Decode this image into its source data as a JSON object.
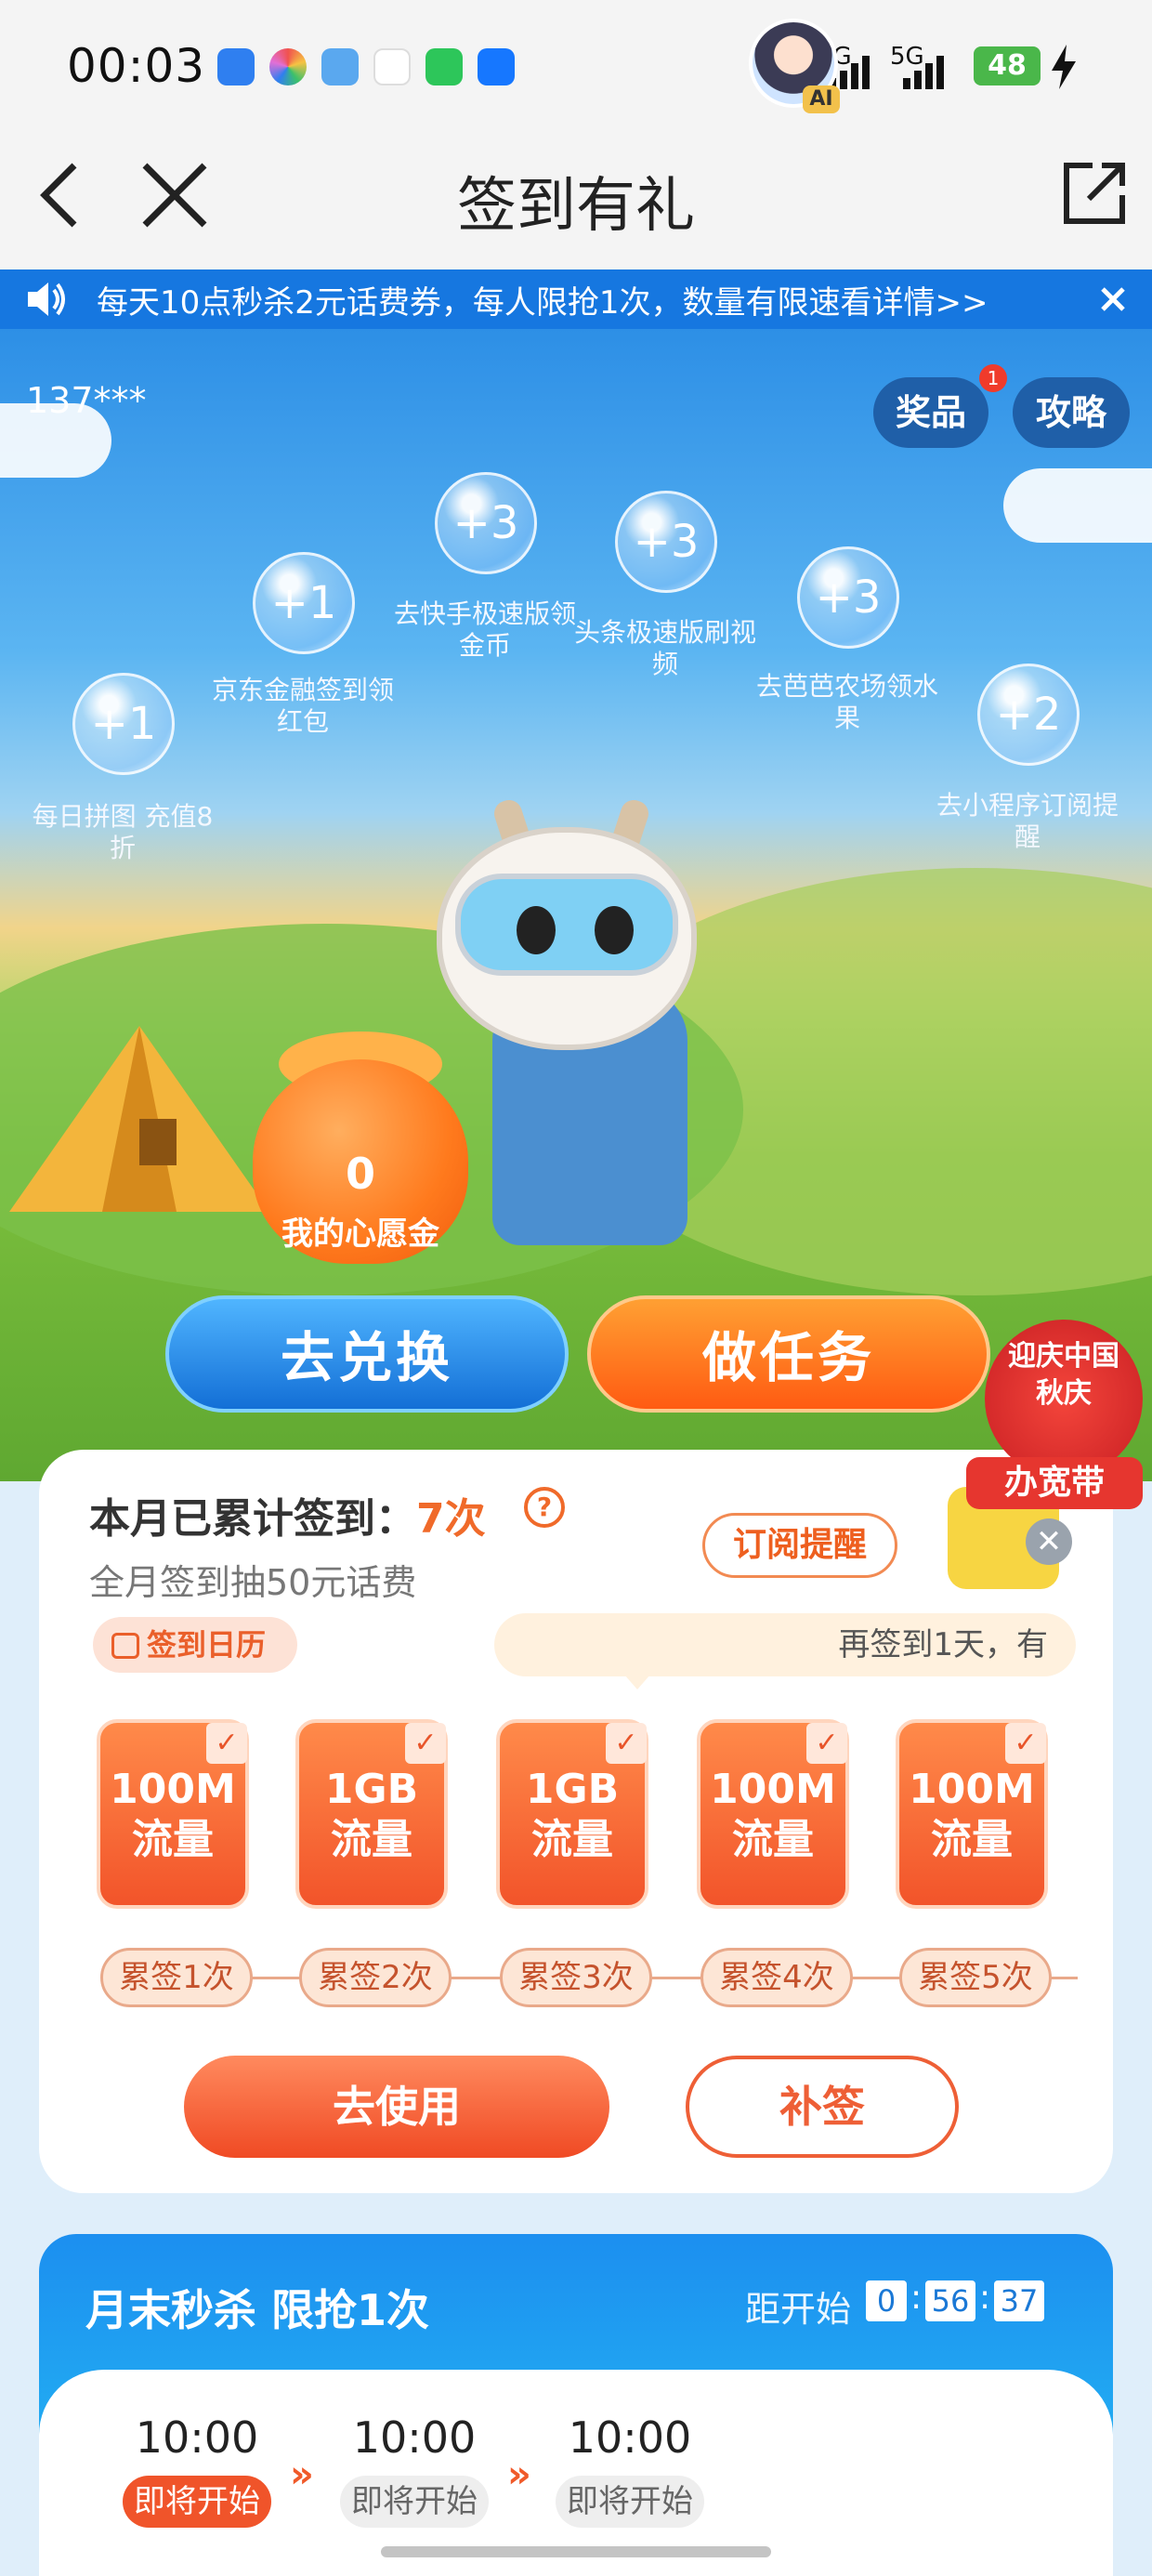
{
  "status_bar": {
    "time": "00:03",
    "net1": "5G",
    "net2": "5G",
    "battery": "48",
    "app_icons": [
      {
        "name": "blue-app-icon",
        "color": "#2f7ff0"
      },
      {
        "name": "colorful-app-icon",
        "color": "#e26fd6"
      },
      {
        "name": "weather-app-icon",
        "color": "#5aa8ef"
      },
      {
        "name": "news-app-icon",
        "color": "#cc2a2a"
      },
      {
        "name": "green-app-icon",
        "color": "#2dc65a"
      },
      {
        "name": "alipay-app-icon",
        "color": "#1677ff"
      }
    ]
  },
  "nav": {
    "title": "签到有礼"
  },
  "notice": {
    "text": "每天10点秒杀2元话费券，每人限抢1次，数量有限速看详情>>"
  },
  "hero": {
    "phone": "137***",
    "prizes_label": "奖品",
    "prizes_badge": "1",
    "strategy_label": "攻略",
    "ai_tag": "AI",
    "tasks": [
      {
        "points": "+1",
        "label": "每日拼图 充值8折"
      },
      {
        "points": "+1",
        "label": "京东金融签到领红包"
      },
      {
        "points": "+3",
        "label": "去快手极速版领金币"
      },
      {
        "points": "+3",
        "label": "头条极速版刷视频"
      },
      {
        "points": "+3",
        "label": "去芭芭农场领水果"
      },
      {
        "points": "+2",
        "label": "去小程序订阅提醒"
      }
    ],
    "wish_amount": "0",
    "wish_label": "我的心愿金",
    "exchange_button": "去兑换",
    "task_button": "做任务",
    "badge_text": "迎庆中国秋庆",
    "broadband_text": "办宽带"
  },
  "signin": {
    "title_prefix": "本月已累计签到：",
    "count": "7次",
    "help": "?",
    "subtitle": "全月签到抽50元话费",
    "subscribe_button": "订阅提醒",
    "calendar_tag": "签到日历",
    "tip": "再签到1天，有",
    "close": "✕",
    "rewards": [
      {
        "amount": "100M",
        "unit": "流量",
        "checked": "✓",
        "step": "累签1次"
      },
      {
        "amount": "1GB",
        "unit": "流量",
        "checked": "✓",
        "step": "累签2次"
      },
      {
        "amount": "1GB",
        "unit": "流量",
        "checked": "✓",
        "step": "累签3次"
      },
      {
        "amount": "100M",
        "unit": "流量",
        "checked": "✓",
        "step": "累签4次"
      },
      {
        "amount": "100M",
        "unit": "流量",
        "checked": "✓",
        "step": "累签5次"
      }
    ],
    "use_button": "去使用",
    "makeup_button": "补签"
  },
  "flash_sale": {
    "title": "月末秒杀 限抢1次",
    "countdown_label": "距开始",
    "countdown": [
      "0",
      "56",
      "37"
    ],
    "slots": [
      {
        "time": "10:00",
        "status": "即将开始",
        "active": true
      },
      {
        "time": "10:00",
        "status": "即将开始",
        "active": false
      },
      {
        "time": "10:00",
        "status": "即将开始",
        "active": false
      }
    ],
    "arrow": "»"
  }
}
